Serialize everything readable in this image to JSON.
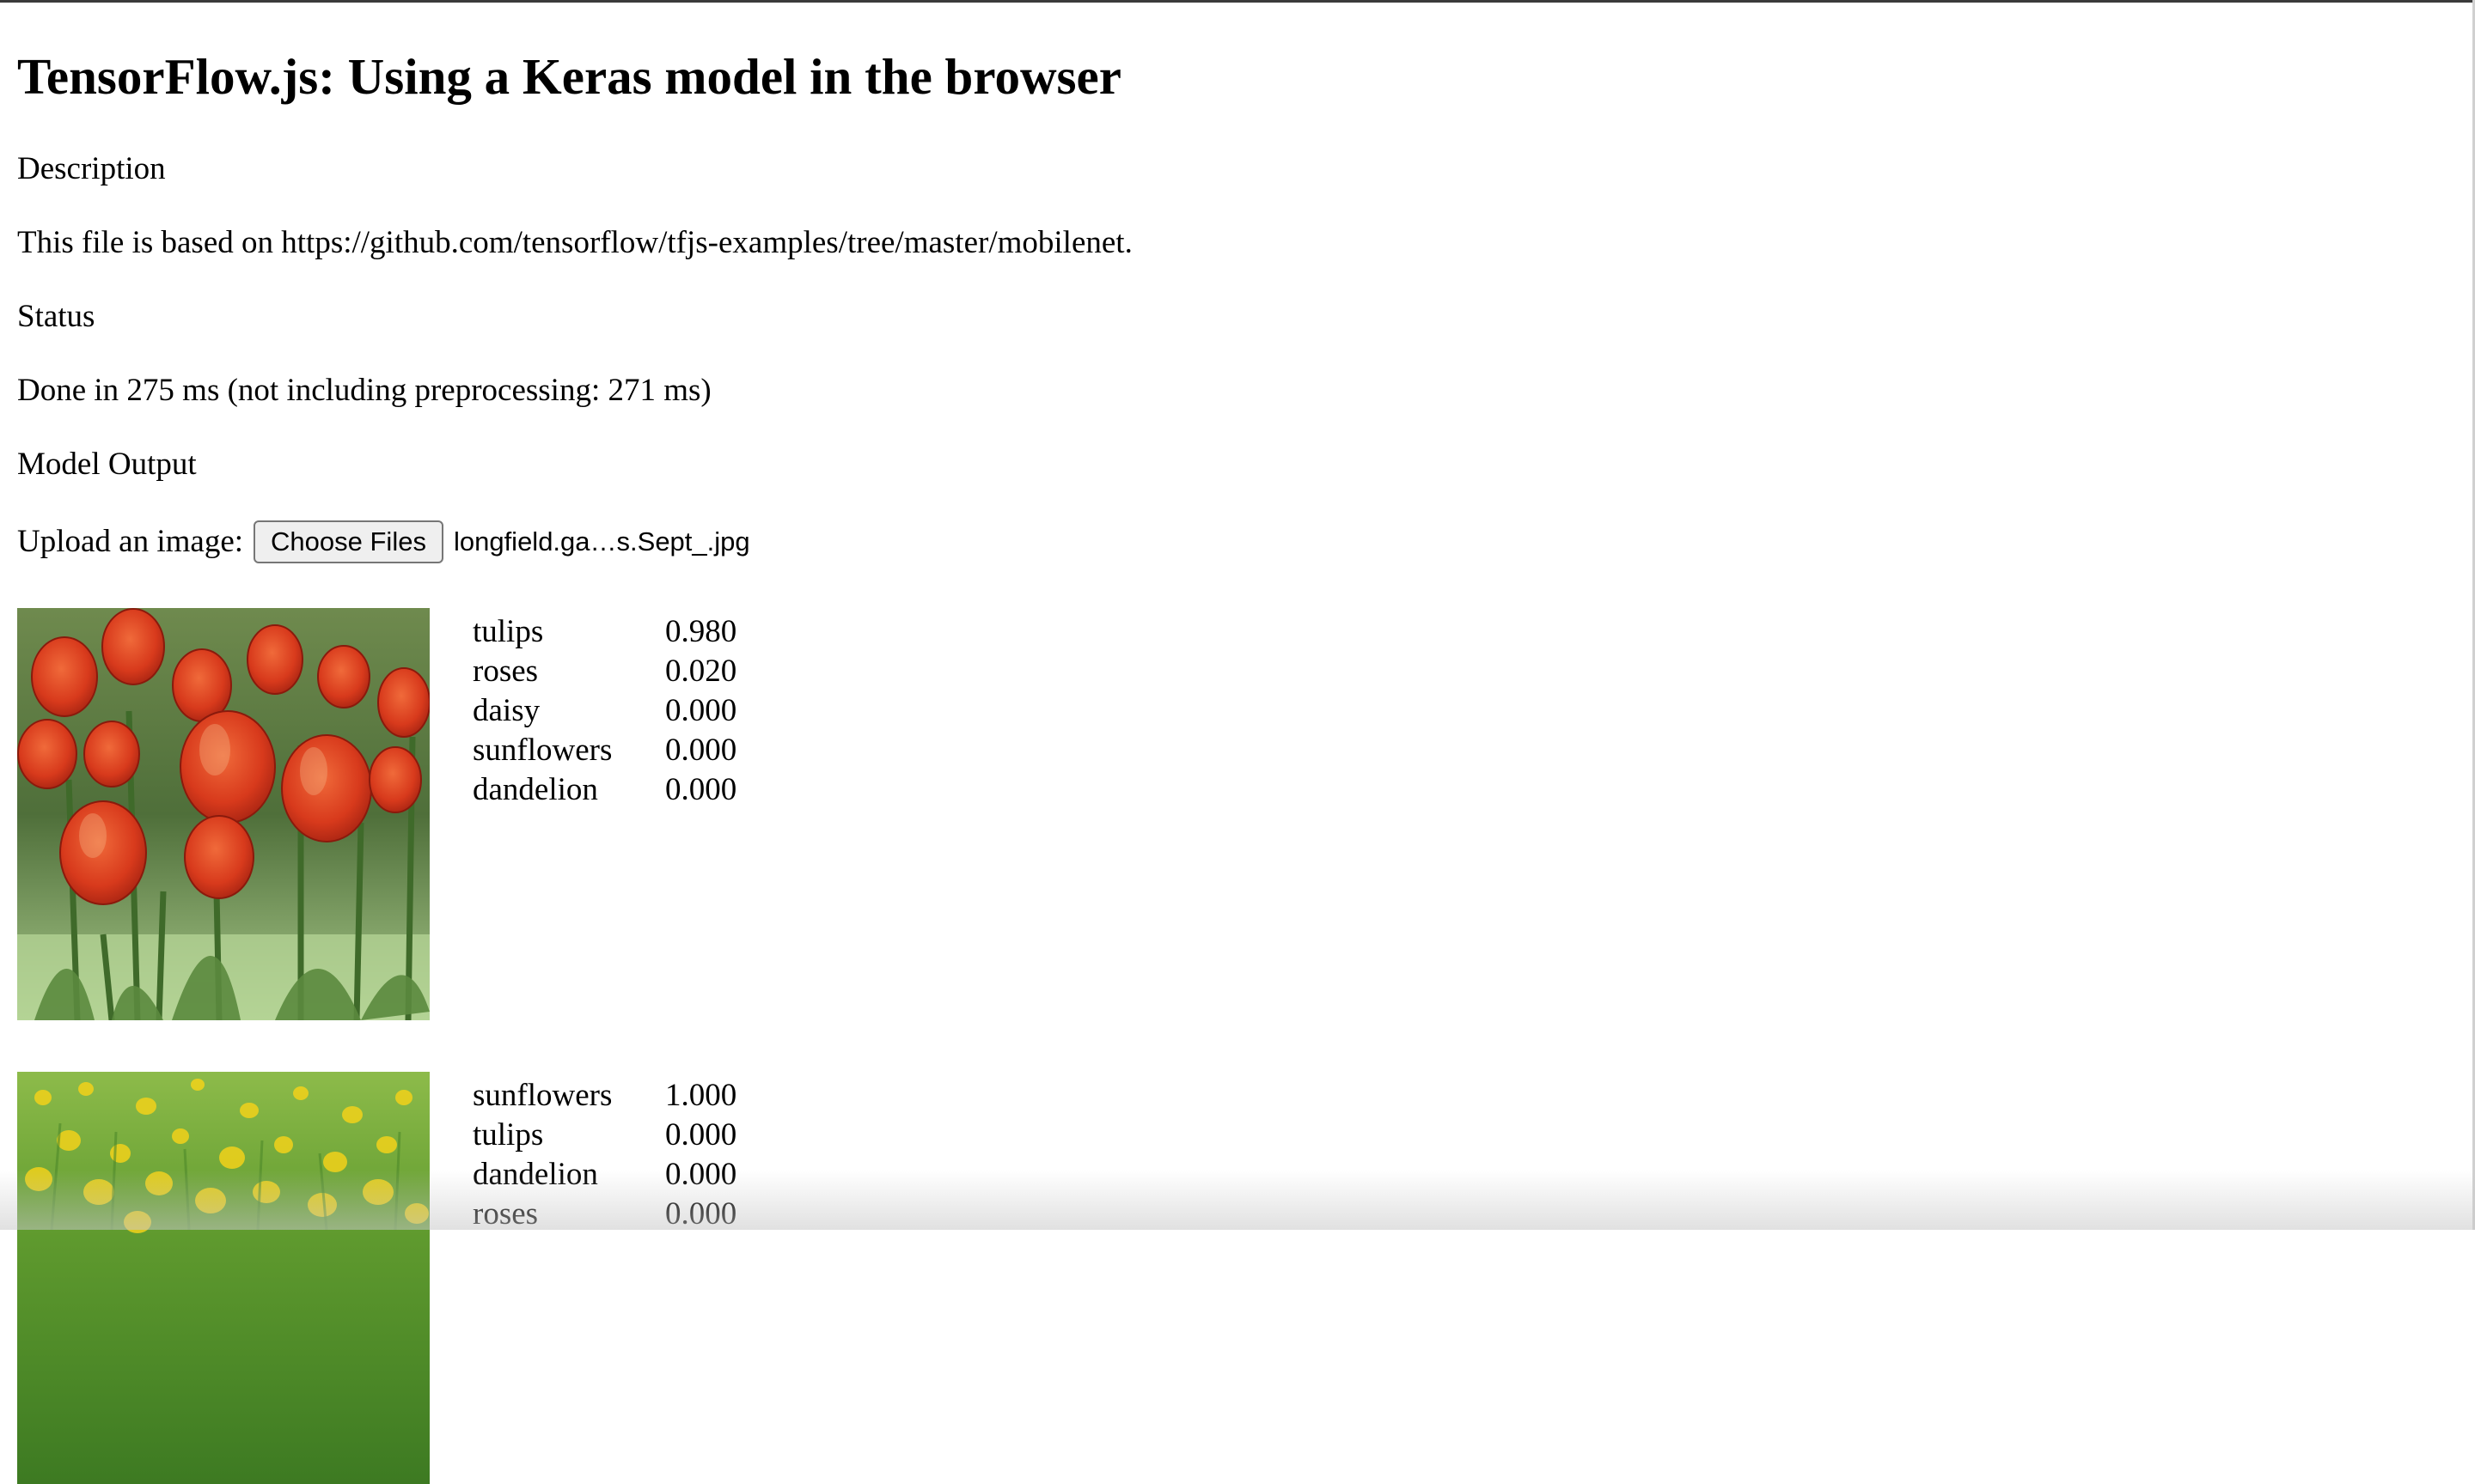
{
  "page": {
    "title": "TensorFlow.js: Using a Keras model in the browser",
    "description_heading": "Description",
    "description_text": "This file is based on https://github.com/tensorflow/tfjs-examples/tree/master/mobilenet.",
    "status_heading": "Status",
    "status_text": "Done in 275 ms (not including preprocessing: 271 ms)",
    "output_heading": "Model Output"
  },
  "upload": {
    "label": "Upload an image:",
    "button_label": "Choose Files",
    "file_name": "longfield.ga…s.Sept_.jpg"
  },
  "results": [
    {
      "image_subject": "red tulips",
      "predictions": [
        {
          "name": "tulips",
          "score": "0.980"
        },
        {
          "name": "roses",
          "score": "0.020"
        },
        {
          "name": "daisy",
          "score": "0.000"
        },
        {
          "name": "sunflowers",
          "score": "0.000"
        },
        {
          "name": "dandelion",
          "score": "0.000"
        }
      ]
    },
    {
      "image_subject": "yellow flowers in grass",
      "predictions": [
        {
          "name": "sunflowers",
          "score": "1.000"
        },
        {
          "name": "tulips",
          "score": "0.000"
        },
        {
          "name": "dandelion",
          "score": "0.000"
        },
        {
          "name": "roses",
          "score": "0.000"
        }
      ]
    }
  ]
}
